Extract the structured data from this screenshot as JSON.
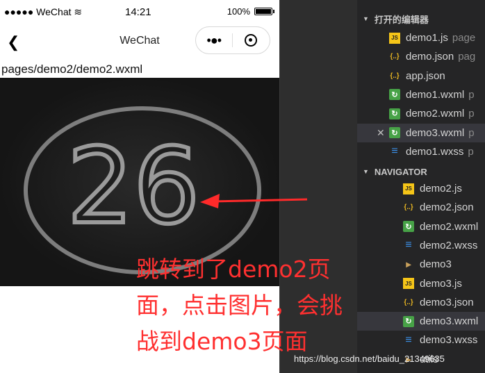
{
  "phone": {
    "status_bar": {
      "carrier": "●●●●● WeChat",
      "wifi_icon": "wifi-icon",
      "time": "14:21",
      "battery": "100%",
      "battery_level": 1.0
    },
    "nav": {
      "back_icon": "chevron-left-icon",
      "title": "WeChat",
      "more_icon": "more-dots-icon",
      "close_icon": "close-circle-icon"
    },
    "page_path": "pages/demo2/demo2.wxml",
    "image": {
      "badge_number": "26"
    }
  },
  "annotation": {
    "text": "跳转到了demo2页面，点击图片，会挑战到demo3页面",
    "color": "#ff2a2a"
  },
  "sidebar": {
    "open_editors": {
      "header": "打开的编辑器",
      "items": [
        {
          "name": "demo1.js",
          "desc": "page",
          "icon": "js"
        },
        {
          "name": "demo.json",
          "desc": "pag",
          "icon": "json"
        },
        {
          "name": "app.json",
          "desc": "",
          "icon": "json"
        },
        {
          "name": "demo1.wxml",
          "desc": "p",
          "icon": "wxml"
        },
        {
          "name": "demo2.wxml",
          "desc": "p",
          "icon": "wxml"
        },
        {
          "name": "demo3.wxml",
          "desc": "p",
          "icon": "wxml",
          "active": true,
          "close": "✕"
        },
        {
          "name": "demo1.wxss",
          "desc": "p",
          "icon": "wxss"
        }
      ]
    },
    "navigator": {
      "header": "NAVIGATOR",
      "items": [
        {
          "name": "demo2.js",
          "icon": "js"
        },
        {
          "name": "demo2.json",
          "icon": "json"
        },
        {
          "name": "demo2.wxml",
          "icon": "wxml"
        },
        {
          "name": "demo2.wxss",
          "icon": "wxss"
        },
        {
          "name": "demo3",
          "icon": "folder"
        },
        {
          "name": "demo3.js",
          "icon": "js"
        },
        {
          "name": "demo3.json",
          "icon": "json"
        },
        {
          "name": "demo3.wxml",
          "icon": "wxml",
          "active": true
        },
        {
          "name": "demo3.wxss",
          "icon": "wxss"
        },
        {
          "name": "utils",
          "icon": "folder"
        }
      ]
    }
  },
  "watermark": "https://blog.csdn.net/baidu_21349635",
  "colors": {
    "sidebar_bg": "#252526",
    "gutter_bg": "#2e2e2e",
    "arrow": "#ff2a2a"
  }
}
